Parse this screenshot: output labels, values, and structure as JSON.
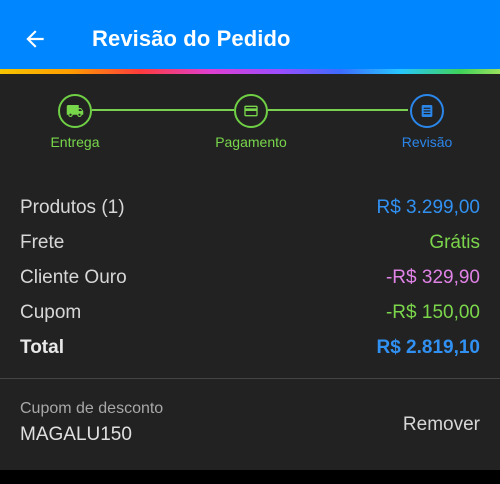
{
  "header": {
    "title": "Revisão do Pedido",
    "back_icon": "arrow-left-icon",
    "background": "#0086ff"
  },
  "stepper": {
    "steps": [
      {
        "label": "Entrega",
        "icon": "truck-icon",
        "state": "done",
        "color": "#78d64b"
      },
      {
        "label": "Pagamento",
        "icon": "card-icon",
        "state": "done",
        "color": "#78d64b"
      },
      {
        "label": "Revisão",
        "icon": "list-icon",
        "state": "current",
        "color": "#2b86ea"
      }
    ]
  },
  "summary": {
    "rows": [
      {
        "label": "Produtos (1)",
        "value": "R$ 3.299,00",
        "color": "#3191f2"
      },
      {
        "label": "Frete",
        "value": "Grátis",
        "color": "#7bd64b"
      },
      {
        "label": "Cliente Ouro",
        "value": "-R$ 329,90",
        "color": "#e082e6"
      },
      {
        "label": "Cupom",
        "value": "-R$ 150,00",
        "color": "#7bd64b"
      }
    ],
    "total": {
      "label": "Total",
      "value": "R$ 2.819,10",
      "color": "#3191f2"
    }
  },
  "coupon": {
    "label": "Cupom de desconto",
    "code": "MAGALU150",
    "remove_label": "Remover"
  }
}
